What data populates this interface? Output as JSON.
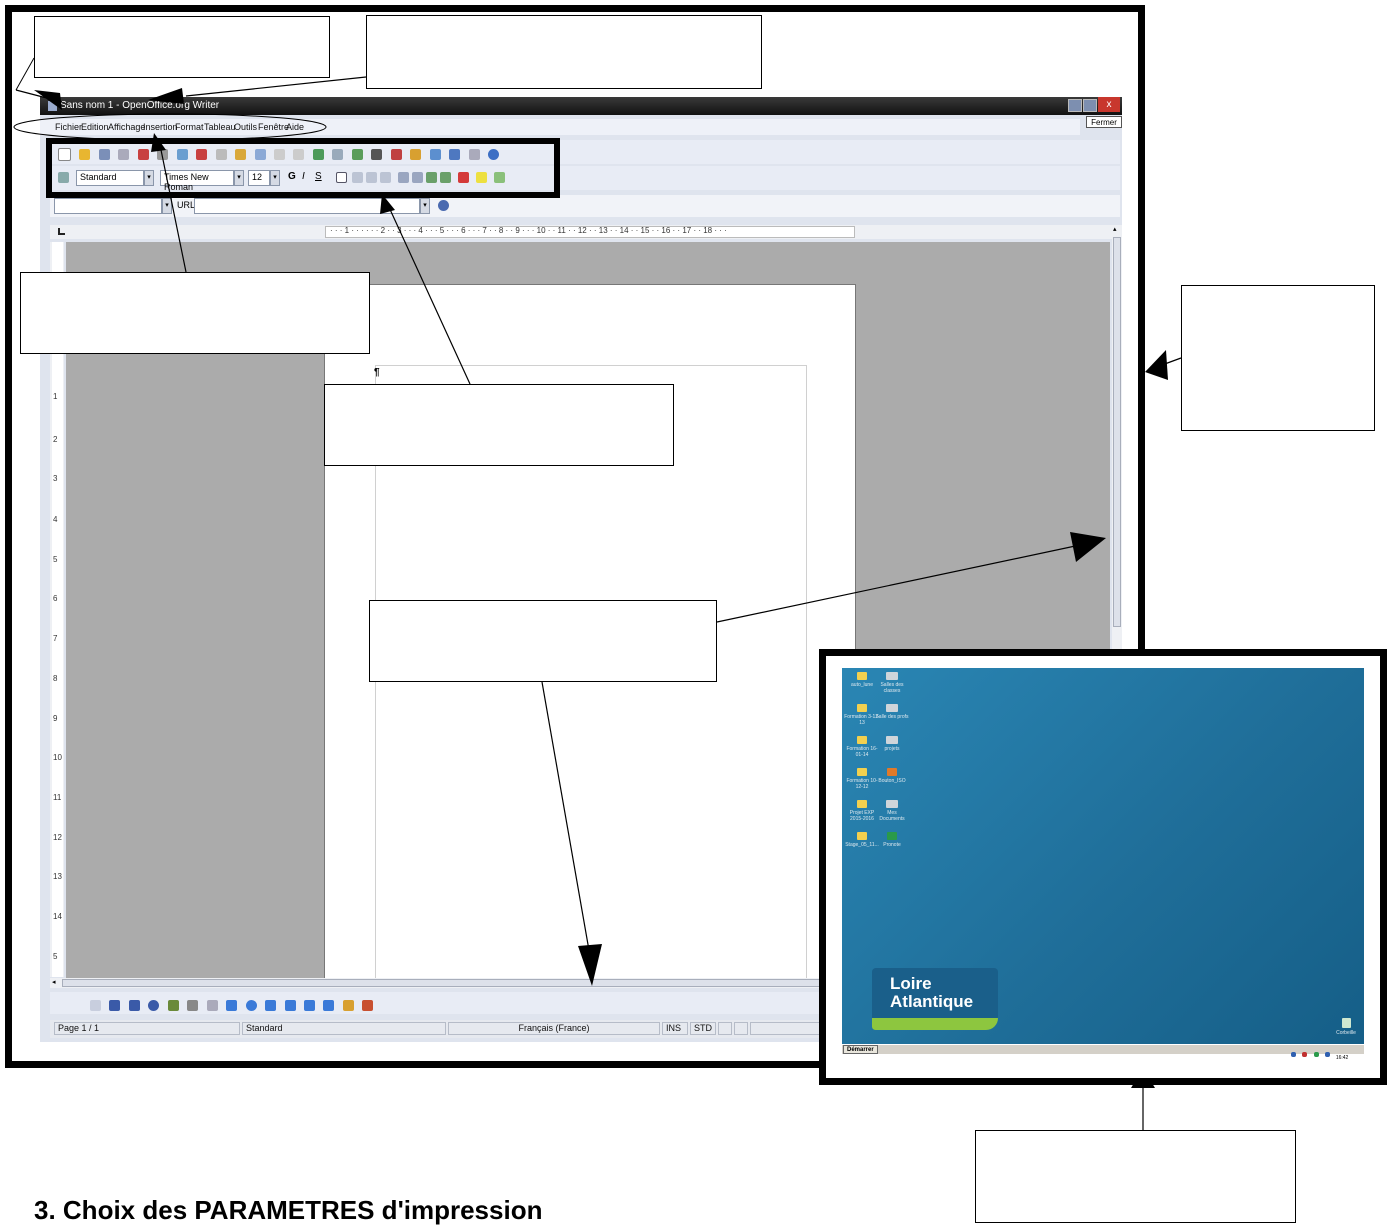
{
  "window": {
    "title": "Sans nom 1 - OpenOffice.org Writer",
    "close_tooltip": "Fermer",
    "menu": [
      "Fichier",
      "Edition",
      "Affichage",
      "Insertion",
      "Format",
      "Tableau",
      "Outils",
      "Fenêtre",
      "Aide"
    ],
    "style_value": "Standard",
    "font_value": "Times New Roman",
    "size_value": "12",
    "bold": "G",
    "italic": "I",
    "underline": "S",
    "url_label": "URL :",
    "ruler_h": "· · · 1 · · ·  · · · 2 · · 3 · · · 4 · · · 5 · · · 6 · · · 7 · · 8 · · 9 · · · 10 · · 11 · · 12 · · 13 · · 14 · · 15 · · 16 · · 17 · · 18 · · ·",
    "ruler_v": [
      "1",
      "2",
      "3",
      "4",
      "5",
      "6",
      "7",
      "8",
      "9",
      "10",
      "11",
      "12",
      "13",
      "14",
      "5"
    ],
    "status": {
      "page": "Page 1 / 1",
      "style": "Standard",
      "language": "Français (France)",
      "ins": "INS",
      "std": "STD"
    }
  },
  "desktop": {
    "icons": [
      {
        "label": "auto_lune",
        "type": "folder"
      },
      {
        "label": "Salles des classes",
        "type": "drive"
      },
      {
        "label": "Formation 3-12-13",
        "type": "folder"
      },
      {
        "label": "Salle des profs",
        "type": "drive"
      },
      {
        "label": "Formation 16-01-14",
        "type": "folder"
      },
      {
        "label": "projets",
        "type": "drive"
      },
      {
        "label": "Formation 10-12-12",
        "type": "folder"
      },
      {
        "label": "Bouton_ISO",
        "type": "app"
      },
      {
        "label": "Projet EXP 2015-2016",
        "type": "folder"
      },
      {
        "label": "Mes Documents",
        "type": "drive"
      },
      {
        "label": "Stage_05_11...",
        "type": "folder"
      },
      {
        "label": "Pronote",
        "type": "pronote"
      }
    ],
    "logo_line1": "Loire",
    "logo_line2": "Atlantique",
    "recycle_label": "Corbeille",
    "start_label": "Démarrer",
    "clock": "16:42"
  },
  "heading": "3. Choix des PARAMETRES d'impression",
  "colors": {
    "desktop_blue": "#1f6e99",
    "page_gray": "#ababab"
  }
}
